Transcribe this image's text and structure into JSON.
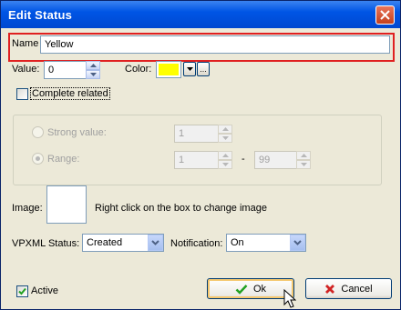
{
  "window": {
    "title": "Edit Status"
  },
  "name": {
    "label": "Name",
    "value": "Yellow"
  },
  "value": {
    "label": "Value:",
    "value": "0"
  },
  "color": {
    "label": "Color:",
    "swatch": "#ffff00",
    "more_label": "..."
  },
  "complete_related": {
    "label": "Complete related",
    "checked": false
  },
  "strong_value": {
    "label": "Strong value:",
    "value": "1"
  },
  "range": {
    "label": "Range:",
    "from": "1",
    "separator": "-",
    "to": "99"
  },
  "image": {
    "label": "Image:",
    "hint": "Right click on the box to  change image"
  },
  "vpxml_status": {
    "label": "VPXML Status:",
    "selected": "Created"
  },
  "notification": {
    "label": "Notification:",
    "selected": "On"
  },
  "active": {
    "label": "Active",
    "checked": true
  },
  "buttons": {
    "ok_label": "Ok",
    "cancel_label": "Cancel"
  },
  "colors": {
    "title_bar": "#0055e5",
    "highlight": "#e02020",
    "face": "#ece9d8"
  }
}
